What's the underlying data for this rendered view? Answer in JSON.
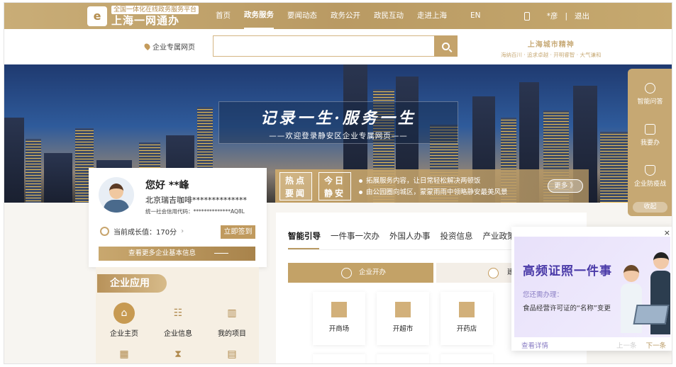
{
  "header": {
    "logo_sub": "全国一体化在线政务服务平台",
    "logo_main": "上海一网通办",
    "nav": [
      {
        "label": "首页"
      },
      {
        "label": "政务服务"
      },
      {
        "label": "要闻动态"
      },
      {
        "label": "政务公开"
      },
      {
        "label": "政民互动"
      },
      {
        "label": "走进上海"
      },
      {
        "label": "EN"
      }
    ],
    "user_name": "*彦",
    "separator": "|",
    "logout": "退出"
  },
  "search": {
    "location": "企业专属网页",
    "placeholder": ""
  },
  "city_spirit": {
    "title": "上海城市精神",
    "subtitle": "海纳百川 · 追求卓越 · 开明睿智 · 大气谦和"
  },
  "banner": {
    "slogan_main": "记录一生·服务一生",
    "slogan_sub": "——欢迎登录静安区企业专属网页——"
  },
  "hot_news": {
    "tag1": "热点要闻",
    "tag2": "今日静安",
    "items": [
      "拓展服务内容，让日常轻松解决两顿饭",
      "由公园圈向城区，蒙蒙雨雨中领略静安最美风景"
    ],
    "more": "更多 》"
  },
  "user": {
    "greeting": "您好 **峰",
    "company": "北京瑞吉咖啡**************",
    "credit_code": "统一社会信用代码：**************AQ8L",
    "growth": "当前成长值：170分",
    "signin": "立即签到",
    "more_info": "查看更多企业基本信息"
  },
  "apps": {
    "title": "企业应用",
    "items": [
      {
        "label": "企业主页",
        "icon": "home-icon"
      },
      {
        "label": "企业信息",
        "icon": "users-icon"
      },
      {
        "label": "我的项目",
        "icon": "books-icon"
      },
      {
        "label": "",
        "icon": "qrcode-icon"
      },
      {
        "label": "",
        "icon": "hourglass-icon"
      },
      {
        "label": "",
        "icon": "calendar-icon"
      }
    ]
  },
  "main": {
    "tabs": [
      {
        "label": "智能引导"
      },
      {
        "label": "一件事一次办"
      },
      {
        "label": "外国人办事"
      },
      {
        "label": "投资信息"
      },
      {
        "label": "产业政策"
      }
    ],
    "sub_tabs": [
      {
        "label": "企业开办"
      },
      {
        "label": "建设"
      }
    ],
    "services": [
      {
        "label": "开商场"
      },
      {
        "label": "开超市"
      },
      {
        "label": "开药店"
      }
    ]
  },
  "side": {
    "items": [
      {
        "label": "智能问答",
        "icon": "robot-icon"
      },
      {
        "label": "我要办",
        "icon": "edit-icon"
      },
      {
        "label": "企业防疫战",
        "icon": "shield-icon"
      }
    ],
    "collapse": "收起"
  },
  "popup": {
    "close": "×",
    "title": "高频证照一件事",
    "question": "您还需办理：",
    "desc": "食品经营许可证的“名称”变更",
    "link": "查看详情",
    "prev": "上一条",
    "next": "下一条"
  }
}
